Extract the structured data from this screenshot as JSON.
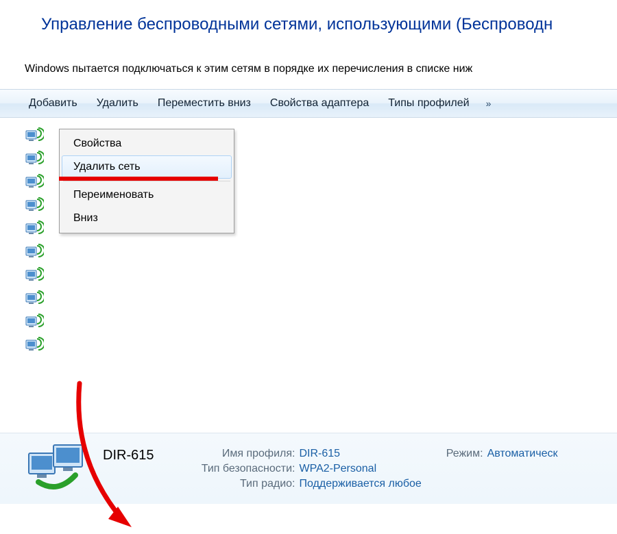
{
  "header": {
    "title": "Управление беспроводными сетями, использующими (Беспроводн",
    "description": "Windows пытается подключаться к этим сетям в порядке их перечисления в списке ниж"
  },
  "toolbar": {
    "add": "Добавить",
    "remove": "Удалить",
    "move_down": "Переместить вниз",
    "adapter_props": "Свойства адаптера",
    "profile_types": "Типы профилей",
    "more": "»"
  },
  "context_menu": {
    "properties": "Свойства",
    "delete_network": "Удалить сеть",
    "rename": "Переименовать",
    "down": "Вниз"
  },
  "details": {
    "name": "DIR-615",
    "profile_name_label": "Имя профиля:",
    "profile_name_value": "DIR-615",
    "security_type_label": "Тип безопасности:",
    "security_type_value": "WPA2-Personal",
    "radio_type_label": "Тип радио:",
    "radio_type_value": "Поддерживается любое",
    "mode_label": "Режим:",
    "mode_value": "Автоматическ"
  }
}
